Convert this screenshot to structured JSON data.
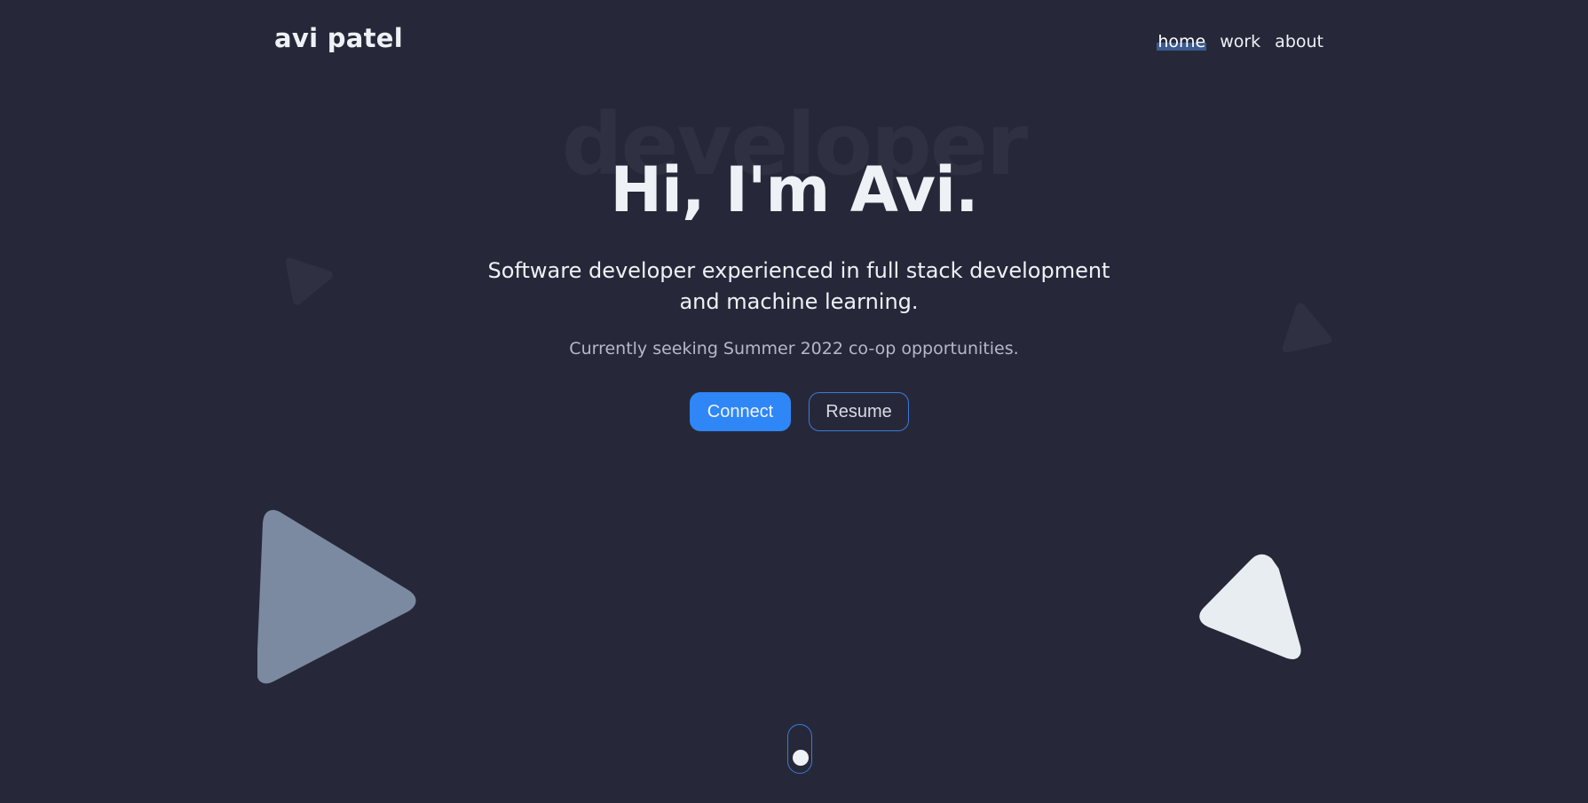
{
  "header": {
    "brand": "avi patel",
    "nav": [
      {
        "label": "home",
        "active": true
      },
      {
        "label": "work",
        "active": false
      },
      {
        "label": "about",
        "active": false
      }
    ]
  },
  "hero": {
    "background_word": "developer",
    "headline": "Hi, I'm Avi.",
    "tagline": "Software developer experienced in full stack development and machine learning.",
    "seeking": "Currently seeking Summer 2022 co-op opportunities.",
    "buttons": {
      "connect": "Connect",
      "resume": "Resume"
    }
  },
  "colors": {
    "background": "#262839",
    "accent": "#2f86f6",
    "text": "#eef1f5",
    "muted_text": "#b4b9c8",
    "triangle_gray": "#7b8aa1",
    "triangle_white": "#e8edf1"
  },
  "icons": {
    "scroll_indicator": "mouse-scroll-icon"
  }
}
